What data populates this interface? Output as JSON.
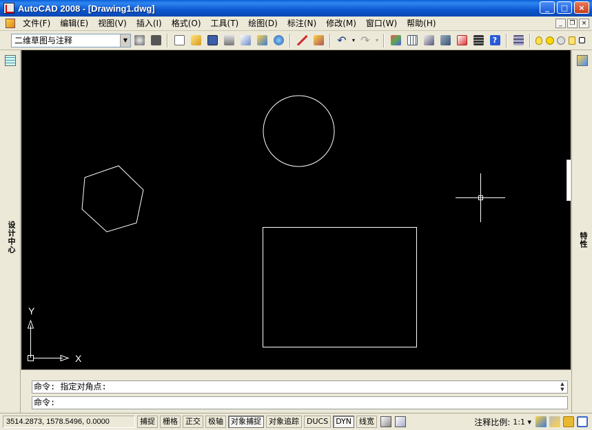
{
  "window": {
    "title": "AutoCAD 2008 - [Drawing1.dwg]",
    "controls": {
      "minimize": "_",
      "maximize": "□",
      "close": "×"
    }
  },
  "menu": {
    "items": [
      "文件(F)",
      "编辑(E)",
      "视图(V)",
      "插入(I)",
      "格式(O)",
      "工具(T)",
      "绘图(D)",
      "标注(N)",
      "修改(M)",
      "窗口(W)",
      "帮助(H)"
    ]
  },
  "toolbar": {
    "workspace_value": "二维草图与注释",
    "icons": [
      "new-icon",
      "open-icon",
      "save-icon",
      "plot-icon",
      "plot-preview-icon",
      "publish-icon",
      "3d-dwf-icon",
      "match-properties-icon",
      "block-editor-icon",
      "undo-icon",
      "redo-icon",
      "pan-icon",
      "zoom-icon",
      "design-center-icon",
      "properties-icon",
      "tool-palettes-icon",
      "sheet-set-icon",
      "markup-icon",
      "calculator-icon",
      "help-icon",
      "layer-icon",
      "light-bulb-icon",
      "sun-icon",
      "freeze-icon",
      "lock-icon"
    ]
  },
  "palettes": {
    "left_label": "设计中心",
    "right_label": "特性"
  },
  "canvas": {
    "background": "#000000",
    "line_color": "#ffffff",
    "ucs": {
      "x_label": "X",
      "y_label": "Y"
    }
  },
  "command": {
    "history_line": "命令: 指定对角点:",
    "prompt_line": "命令:"
  },
  "status": {
    "coordinates": "3514.2873, 1578.5496, 0.0000",
    "toggles": [
      {
        "label": "捕捉",
        "on": false
      },
      {
        "label": "栅格",
        "on": false
      },
      {
        "label": "正交",
        "on": false
      },
      {
        "label": "极轴",
        "on": false
      },
      {
        "label": "对象捕捉",
        "on": true
      },
      {
        "label": "对象追踪",
        "on": false
      },
      {
        "label": "DUCS",
        "on": false
      },
      {
        "label": "DYN",
        "on": true
      },
      {
        "label": "线宽",
        "on": false
      }
    ],
    "annotation_scale_label": "注释比例:",
    "annotation_scale_value": "1:1 ▾"
  }
}
